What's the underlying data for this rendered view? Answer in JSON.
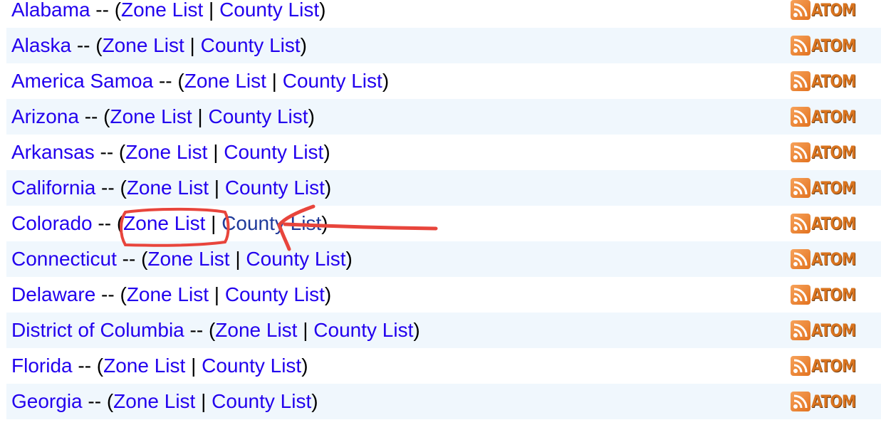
{
  "separator": " -- (",
  "pipe": " | ",
  "close": ")",
  "zone_label": "Zone List",
  "county_label": "County List",
  "feed_label": "ATOM",
  "feed_icon": "rss-feed-icon",
  "colors": {
    "link": "#2200ee",
    "visited_link": "#1f3a9a",
    "row_alt": "#f0f7fd",
    "annotation": "#e8453c",
    "feed": "#e2721f"
  },
  "states": [
    {
      "name": "Alabama"
    },
    {
      "name": "Alaska"
    },
    {
      "name": "America Samoa"
    },
    {
      "name": "Arizona"
    },
    {
      "name": "Arkansas"
    },
    {
      "name": "California"
    },
    {
      "name": "Colorado",
      "highlighted": true
    },
    {
      "name": "Connecticut"
    },
    {
      "name": "Delaware"
    },
    {
      "name": "District of Columbia"
    },
    {
      "name": "Florida"
    },
    {
      "name": "Georgia"
    }
  ]
}
